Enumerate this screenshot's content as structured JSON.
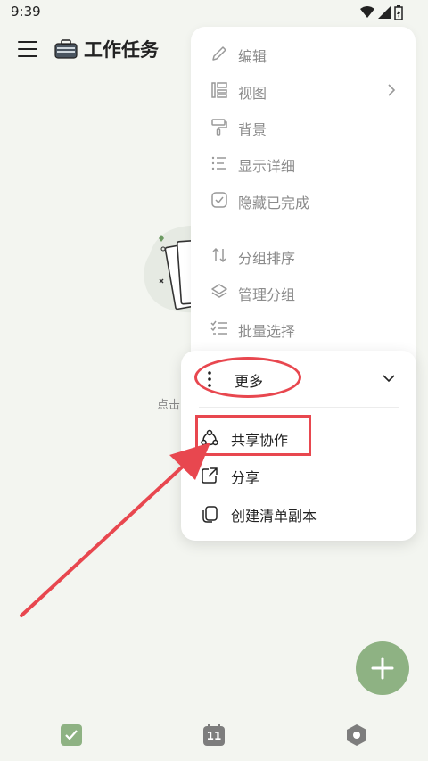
{
  "status_bar": {
    "time": "9:39"
  },
  "header": {
    "title": "工作任务"
  },
  "empty_state": {
    "hint": "点击"
  },
  "menu": {
    "items": [
      {
        "label": "编辑",
        "icon": "pencil-icon"
      },
      {
        "label": "视图",
        "icon": "view-layout-icon"
      },
      {
        "label": "背景",
        "icon": "paint-roller-icon"
      },
      {
        "label": "显示详细",
        "icon": "list-detail-icon"
      },
      {
        "label": "隐藏已完成",
        "icon": "check-hide-icon"
      },
      {
        "label": "分组排序",
        "icon": "sort-arrows-icon"
      },
      {
        "label": "管理分组",
        "icon": "layers-icon"
      },
      {
        "label": "批量选择",
        "icon": "checklist-icon"
      }
    ]
  },
  "more_menu": {
    "title": "更多",
    "items": [
      {
        "label": "共享协作",
        "icon": "collaboration-icon"
      },
      {
        "label": "分享",
        "icon": "share-external-icon"
      },
      {
        "label": "创建清单副本",
        "icon": "copy-icon"
      }
    ]
  },
  "bottom_nav": {
    "calendar_day": "11"
  },
  "colors": {
    "accent": "#8eb283",
    "annotation": "#e8474f",
    "muted_text": "#8c8c8c"
  }
}
